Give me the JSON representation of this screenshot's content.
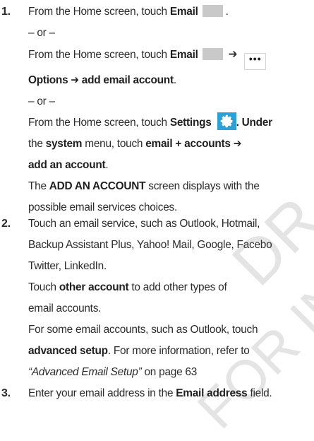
{
  "watermark": [
    "DR",
    "FOR INTER"
  ],
  "steps": [
    {
      "num": "1.",
      "l1_pre": "From the Home screen, touch ",
      "l1_bold": "Email",
      "l1_post": ".",
      "or1": "– or –",
      "l2_pre": "From the Home screen, touch ",
      "l2_bold": "Email",
      "l2_arrow": "➔",
      "l3_bold": "Options ➔ add email account",
      "l3_post": ".",
      "or2": "– or –",
      "l4_pre": "From the Home screen, touch ",
      "l4_bold": "Settings",
      "l4_post": ". Under",
      "l5_pre": "the ",
      "l5_bold1": "system",
      "l5_mid": " menu, touch ",
      "l5_bold2": "email + accounts ➔",
      "l6_bold": "add an account",
      "l6_post": ".",
      "l7_pre": "The ",
      "l7_bold": "ADD AN ACCOUNT",
      "l7_post": " screen displays with the",
      "l8": "possible email services choices."
    },
    {
      "num": "2.",
      "l1": "Touch an email service, such as Outlook, Hotmail,",
      "l2": "Backup Assistant Plus, Yahoo! Mail, Google, Facebo",
      "l3": "Twitter, LinkedIn.",
      "l4_pre": "Touch ",
      "l4_bold": "other account",
      "l4_post": " to add other types of",
      "l5": "email accounts.",
      "l6": "For some email accounts, such as Outlook, touch",
      "l7_bold": "advanced setup",
      "l7_post": ". For more information, refer to",
      "l8_em": "“Advanced Email Setup”",
      "l8_post": " on page 63"
    },
    {
      "num": "3.",
      "l1_pre": "Enter your email address in the ",
      "l1_bold": "Email address",
      "l1_post": " field."
    }
  ],
  "icons": {
    "email_tile": "email-tile-icon",
    "more": "more-options-icon",
    "settings": "settings-gear-icon",
    "settings_color": "#2aa2d8",
    "tile_color": "#c9c9c9"
  }
}
